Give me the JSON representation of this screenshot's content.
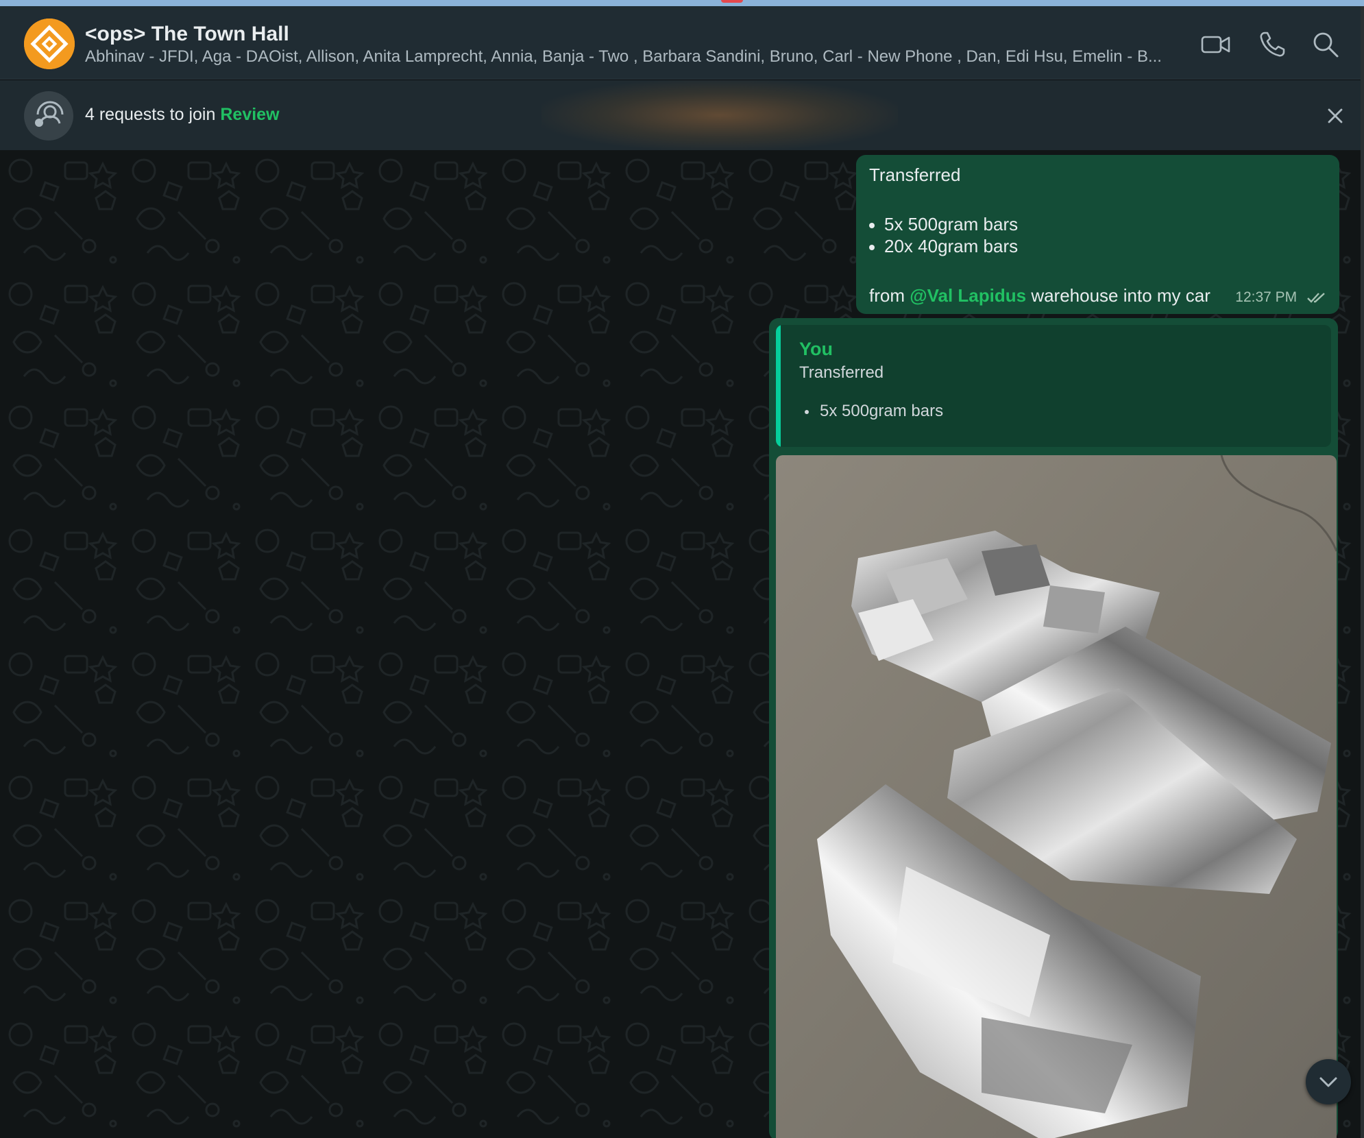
{
  "header": {
    "title": "<ops> The Town Hall",
    "participants": "Abhinav - JFDI, Aga - DAOist, Allison, Anita Lamprecht, Annia, Banja - Two , Barbara Sandini, Bruno, Carl - New Phone , Dan, Edi Hsu, Emelin - B...",
    "icons": [
      "video-call-icon",
      "voice-call-icon",
      "search-icon"
    ]
  },
  "join_banner": {
    "text": "4 requests to join",
    "link_label": "Review",
    "close_icon": "close-icon"
  },
  "messages": [
    {
      "heading": "Transferred",
      "items": [
        "5x 500gram bars",
        "20x 40gram bars"
      ],
      "footer_prefix": "from",
      "mention": "@Val Lapidus",
      "footer_suffix": "warehouse into my car",
      "time": "12:37 PM",
      "status_icon": "double-check-icon"
    },
    {
      "quote": {
        "author": "You",
        "heading": "Transferred",
        "item": "5x 500gram bars"
      },
      "attachment": "photo of foil-wrapped bars"
    }
  ],
  "colors": {
    "header_bg": "#202c33",
    "chat_bg": "#111516",
    "outgoing_bubble": "#144d37",
    "accent_green": "#21c063",
    "quote_bar": "#06cf9c",
    "avatar_orange": "#f39a1f"
  }
}
